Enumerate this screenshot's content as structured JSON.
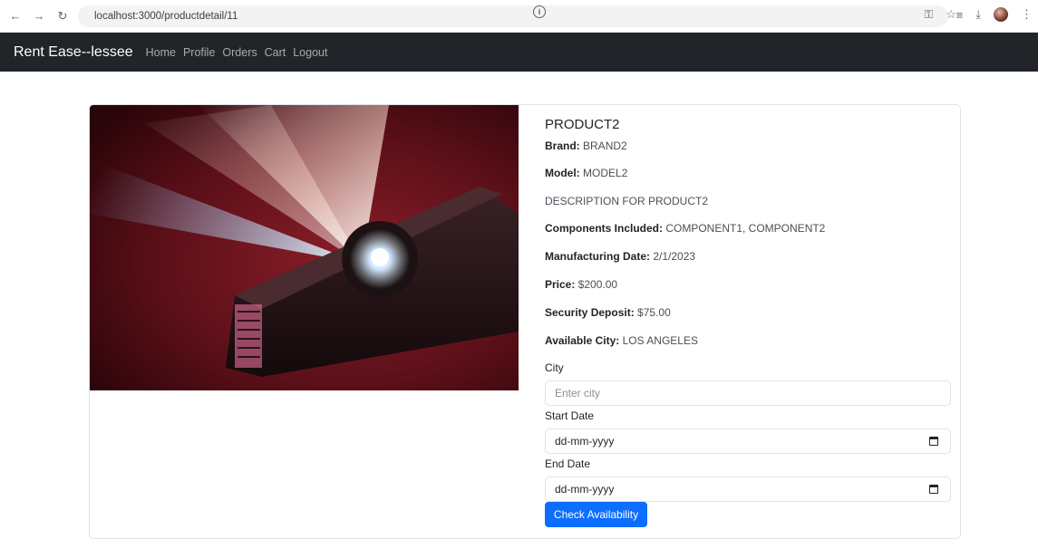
{
  "browser": {
    "url": "localhost:3000/productdetail/11"
  },
  "navbar": {
    "brand": "Rent Ease--lessee",
    "links": [
      "Home",
      "Profile",
      "Orders",
      "Cart",
      "Logout"
    ]
  },
  "product": {
    "title": "PRODUCT2",
    "brand_label": "Brand:",
    "brand": "BRAND2",
    "model_label": "Model:",
    "model": "MODEL2",
    "description": "DESCRIPTION FOR PRODUCT2",
    "components_label": "Components Included:",
    "components": "COMPONENT1, COMPONENT2",
    "mfg_label": "Manufacturing Date:",
    "mfg_date": "2/1/2023",
    "price_label": "Price:",
    "price": "$200.00",
    "deposit_label": "Security Deposit:",
    "deposit": "$75.00",
    "city_label": "Available City:",
    "city": "LOS ANGELES"
  },
  "form": {
    "city_label": "City",
    "city_placeholder": "Enter city",
    "start_label": "Start Date",
    "start_value": "dd-mm-yyyy",
    "end_label": "End Date",
    "end_value": "dd-mm-yyyy",
    "submit_label": "Check Availability"
  },
  "colors": {
    "navbar_bg": "#212529",
    "primary_button": "#0d6efd"
  }
}
